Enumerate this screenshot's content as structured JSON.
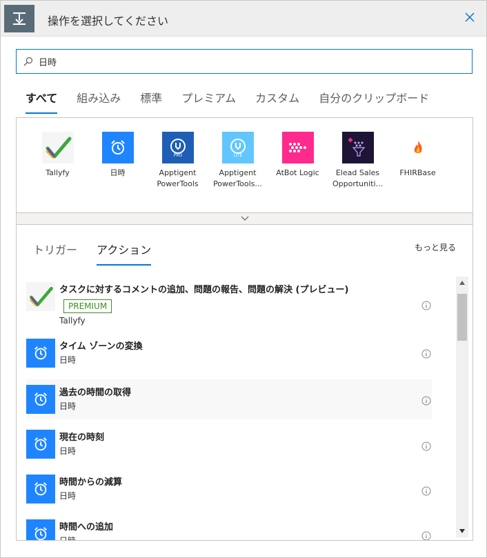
{
  "header": {
    "title": "操作を選択してください",
    "icon": "trigger-step-icon",
    "close_icon": "close-icon"
  },
  "search": {
    "value": "日時",
    "icon": "search-icon"
  },
  "tabs": [
    {
      "label": "すべて",
      "active": true
    },
    {
      "label": "組み込み",
      "active": false
    },
    {
      "label": "標準",
      "active": false
    },
    {
      "label": "プレミアム",
      "active": false
    },
    {
      "label": "カスタム",
      "active": false
    },
    {
      "label": "自分のクリップボード",
      "active": false
    }
  ],
  "connectors": [
    {
      "label": "Tallyfy",
      "icon": "tallyfy-check-icon",
      "color": "#ffffff"
    },
    {
      "label": "日時",
      "icon": "alarm-clock-icon",
      "color": "#1f85ff"
    },
    {
      "label": "Apptigent PowerTools",
      "icon": "apptigent-pro-icon",
      "color": "#1e5eb4"
    },
    {
      "label": "Apptigent PowerTools...",
      "icon": "apptigent-lite-icon",
      "color": "#61c6ff"
    },
    {
      "label": "AtBot Logic",
      "icon": "atbot-logic-icon",
      "color": "#ff2a8d"
    },
    {
      "label": "Elead Sales Opportuniti...",
      "icon": "elead-funnel-icon",
      "color": "#1e1436"
    },
    {
      "label": "FHIRBase",
      "icon": "fhirbase-flame-icon",
      "color": "#ffffff"
    }
  ],
  "expand_icon": "chevron-down-icon",
  "subtabs": [
    {
      "label": "トリガー",
      "active": false
    },
    {
      "label": "アクション",
      "active": true
    }
  ],
  "see_more": "もっと見る",
  "actions": [
    {
      "title": "タスクに対するコメントの追加、問題の報告、問題の解決 (プレビュー)",
      "badge": "PREMIUM",
      "connector": "Tallyfy",
      "icon": "tallyfy-check-icon"
    },
    {
      "title": "タイム ゾーンの変換",
      "connector": "日時",
      "icon": "alarm-clock-icon"
    },
    {
      "title": "過去の時間の取得",
      "connector": "日時",
      "icon": "alarm-clock-icon"
    },
    {
      "title": "現在の時刻",
      "connector": "日時",
      "icon": "alarm-clock-icon"
    },
    {
      "title": "時間からの減算",
      "connector": "日時",
      "icon": "alarm-clock-icon"
    },
    {
      "title": "時間への追加",
      "connector": "日時",
      "icon": "alarm-clock-icon"
    }
  ],
  "colors": {
    "accent": "#0078d4",
    "premium": "#3e8e22",
    "clock_blue": "#1f85ff"
  }
}
